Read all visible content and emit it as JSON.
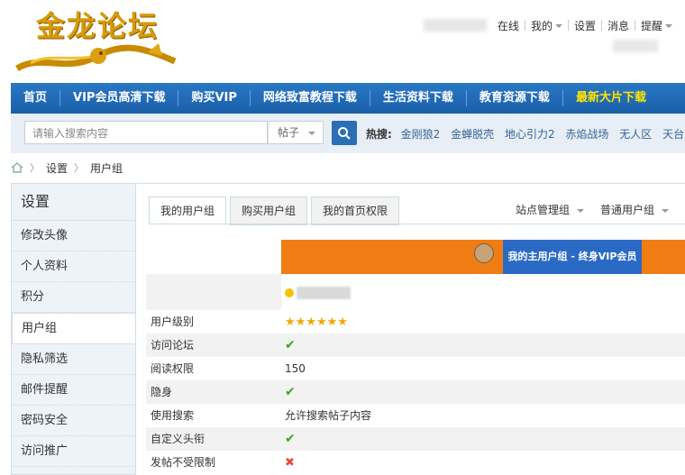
{
  "site": {
    "logo_text": "金龙论坛"
  },
  "toplinks": {
    "items": [
      "在线",
      "我的",
      "设置",
      "消息",
      "提醒"
    ]
  },
  "nav": {
    "items": [
      "首页",
      "VIP会员高清下载",
      "购买VIP",
      "网络致富教程下载",
      "生活资料下载",
      "教育资源下载"
    ],
    "highlight": "最新大片下载"
  },
  "search": {
    "placeholder": "请输入搜索内容",
    "type": "帖子",
    "hot_label": "热搜:",
    "hot_tags": [
      "金刚狼2",
      "金蝉脱壳",
      "地心引力2",
      "赤焰战场",
      "无人区",
      "天台爱情"
    ]
  },
  "breadcrumb": {
    "items": [
      "设置",
      "用户组"
    ]
  },
  "sidebar": {
    "title": "设置",
    "items": [
      "修改头像",
      "个人资料",
      "积分",
      "用户组",
      "隐私筛选",
      "邮件提醒",
      "密码安全",
      "访问推广"
    ],
    "active_index": 3
  },
  "tabs": {
    "items": [
      "我的用户组",
      "购买用户组",
      "我的首页权限"
    ],
    "active_index": 0,
    "right": [
      "站点管理组",
      "普通用户组"
    ]
  },
  "banner": {
    "title": "我的主用户组 - 终身VIP会员"
  },
  "table": {
    "rows": [
      {
        "label": "用户级别",
        "value": "stars",
        "stars": 6
      },
      {
        "label": "访问论坛",
        "value": "check"
      },
      {
        "label": "阅读权限",
        "value": "150"
      },
      {
        "label": "隐身",
        "value": "check"
      },
      {
        "label": "使用搜索",
        "value": "允许搜索帖子内容"
      },
      {
        "label": "自定义头衔",
        "value": "check"
      },
      {
        "label": "发帖不受限制",
        "value": "cross"
      }
    ]
  },
  "colors": {
    "nav_blue": "#1a5fa8",
    "banner_orange": "#f07c14",
    "banner_blue": "#2a6ac4",
    "highlight": "#ffe400"
  }
}
